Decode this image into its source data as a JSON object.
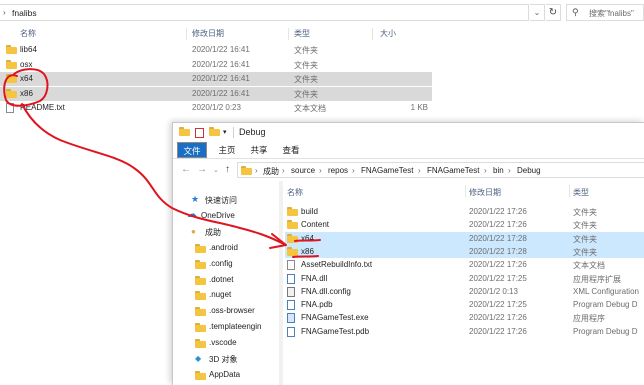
{
  "win1": {
    "path": [
      "fnalibs"
    ],
    "search_placeholder": "搜索\"fnalibs\"",
    "columns": [
      "名称",
      "修改日期",
      "类型",
      "大小"
    ],
    "rows": [
      {
        "name": "lib64",
        "date": "2020/1/22 16:41",
        "type": "文件夹",
        "size": "",
        "icon": "folder-icon"
      },
      {
        "name": "osx",
        "date": "2020/1/22 16:41",
        "type": "文件夹",
        "size": "",
        "icon": "folder-icon"
      },
      {
        "name": "x64",
        "date": "2020/1/22 16:41",
        "type": "文件夹",
        "size": "",
        "icon": "folder-icon",
        "selected": true
      },
      {
        "name": "x86",
        "date": "2020/1/22 16:41",
        "type": "文件夹",
        "size": "",
        "icon": "folder-icon",
        "selected": true
      },
      {
        "name": "README.txt",
        "date": "2020/1/2 0:23",
        "type": "文本文档",
        "size": "1 KB",
        "icon": "text-file-icon"
      }
    ]
  },
  "win2": {
    "title": "Debug",
    "ribbon_tabs": [
      "文件",
      "主页",
      "共享",
      "查看"
    ],
    "path": [
      "成助",
      "source",
      "repos",
      "FNAGameTest",
      "FNAGameTest",
      "bin",
      "Debug"
    ],
    "nav_items": [
      {
        "label": "快速访问",
        "icon": "star-icon"
      },
      {
        "label": "OneDrive",
        "icon": "cloud-icon"
      },
      {
        "label": "成助",
        "icon": "user-icon"
      },
      {
        "label": ".android",
        "icon": "folder-icon"
      },
      {
        "label": ".config",
        "icon": "folder-icon"
      },
      {
        "label": ".dotnet",
        "icon": "folder-icon"
      },
      {
        "label": ".nuget",
        "icon": "folder-icon"
      },
      {
        "label": ".oss-browser",
        "icon": "folder-icon"
      },
      {
        "label": ".templateengin",
        "icon": "folder-icon"
      },
      {
        "label": ".vscode",
        "icon": "folder-icon"
      },
      {
        "label": "3D 对象",
        "icon": "cube-icon"
      },
      {
        "label": "AppData",
        "icon": "folder-icon"
      }
    ],
    "columns": [
      "名称",
      "修改日期",
      "类型"
    ],
    "rows": [
      {
        "name": "build",
        "date": "2020/1/22 17:26",
        "type": "文件夹",
        "icon": "folder-icon"
      },
      {
        "name": "Content",
        "date": "2020/1/22 17:26",
        "type": "文件夹",
        "icon": "folder-icon"
      },
      {
        "name": "x64",
        "date": "2020/1/22 17:28",
        "type": "文件夹",
        "icon": "folder-icon",
        "selected": true
      },
      {
        "name": "x86",
        "date": "2020/1/22 17:28",
        "type": "文件夹",
        "icon": "folder-icon",
        "selected": true
      },
      {
        "name": "AssetRebuildInfo.txt",
        "date": "2020/1/22 17:26",
        "type": "文本文档",
        "icon": "text-file-icon"
      },
      {
        "name": "FNA.dll",
        "date": "2020/1/22 17:25",
        "type": "应用程序扩展",
        "icon": "dll-file-icon"
      },
      {
        "name": "FNA.dll.config",
        "date": "2020/1/2 0:13",
        "type": "XML Configuration",
        "icon": "config-file-icon"
      },
      {
        "name": "FNA.pdb",
        "date": "2020/1/22 17:25",
        "type": "Program Debug D",
        "icon": "pdb-file-icon"
      },
      {
        "name": "FNAGameTest.exe",
        "date": "2020/1/22 17:26",
        "type": "应用程序",
        "icon": "exe-file-icon"
      },
      {
        "name": "FNAGameTest.pdb",
        "date": "2020/1/22 17:26",
        "type": "Program Debug D",
        "icon": "pdb-file-icon"
      }
    ]
  },
  "colors": {
    "selection_gray": "#d9d9d9",
    "selection_blue": "#cce8ff",
    "file_tab": "#1a6fc4",
    "annotation_red": "#e0141e",
    "folder_yellow": "#f5c542"
  }
}
